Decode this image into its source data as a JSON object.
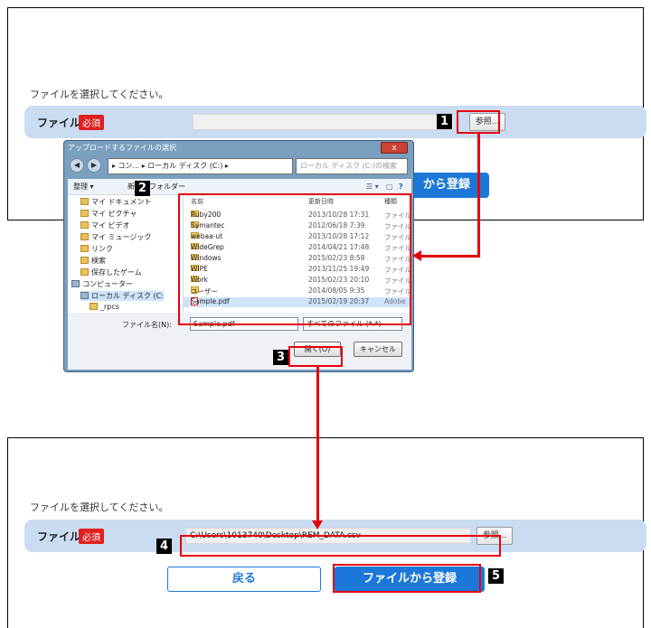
{
  "top_panel": {
    "instruction": "ファイルを選択してください。",
    "file_label": "ファイル",
    "required_badge": "必須",
    "path_value": "",
    "browse_label": "参照..."
  },
  "dialog": {
    "title": "アップロードするファイルの選択",
    "close_label": "x",
    "breadcrumb": "▸ コン... ▸ ローカル ディスク (C:) ▸",
    "search_placeholder": "ローカル ディスク (C:)の検索",
    "toolbar": {
      "organize": "整理 ▾",
      "new_folder": "新しいフォルダー"
    },
    "nav_items": [
      "マイ ドキュメント",
      "マイ ピクチャ",
      "マイ ビデオ",
      "マイ ミュージック",
      "リンク",
      "検索",
      "保存したゲーム",
      "コンピューター",
      "ローカル ディスク (C:",
      "_rpcs"
    ],
    "columns": {
      "name": "名前",
      "date": "更新日時",
      "type": "種類"
    },
    "files": [
      {
        "name": "Ruby200",
        "date": "2013/10/28 17:31",
        "type": "ファイル",
        "icon": "folder"
      },
      {
        "name": "Symantec",
        "date": "2012/06/18 7:39",
        "type": "ファイル",
        "icon": "folder"
      },
      {
        "name": "webaa-ut",
        "date": "2013/10/28 17:12",
        "type": "ファイル",
        "icon": "folder"
      },
      {
        "name": "WideGrep",
        "date": "2014/04/21 17:48",
        "type": "ファイル",
        "icon": "folder"
      },
      {
        "name": "Windows",
        "date": "2015/02/23 8:58",
        "type": "ファイル",
        "icon": "folder"
      },
      {
        "name": "WIPE",
        "date": "2013/11/25 19:49",
        "type": "ファイル",
        "icon": "folder"
      },
      {
        "name": "Work",
        "date": "2015/02/23 20:10",
        "type": "ファイル",
        "icon": "folder"
      },
      {
        "name": "ユーザー",
        "date": "2014/08/05 9:35",
        "type": "ファイル",
        "icon": "folder"
      },
      {
        "name": "Sample.pdf",
        "date": "2015/02/19 20:37",
        "type": "Adobe",
        "icon": "pdf"
      }
    ],
    "filename_label": "ファイル名(N):",
    "filename_value": "Sample.pdf",
    "filetype_value": "すべてのファイル (*.*)",
    "open_label": "開く(O)",
    "cancel_label": "キャンセル"
  },
  "bottom_panel": {
    "instruction": "ファイルを選択してください。",
    "file_label": "ファイル",
    "required_badge": "必須",
    "path_value": "C:\\Users\\1013740\\Desktop\\REM_DATA.csv",
    "browse_label": "参照...",
    "back_label": "戻る",
    "register_label": "ファイルから登録"
  },
  "top_register_partial": "から登録",
  "step_numbers": [
    "1",
    "2",
    "3",
    "4",
    "5"
  ],
  "colors": {
    "accent_blue": "#1c78d8",
    "highlight_red": "#e8000b",
    "row_bg": "#c9dcf2"
  }
}
